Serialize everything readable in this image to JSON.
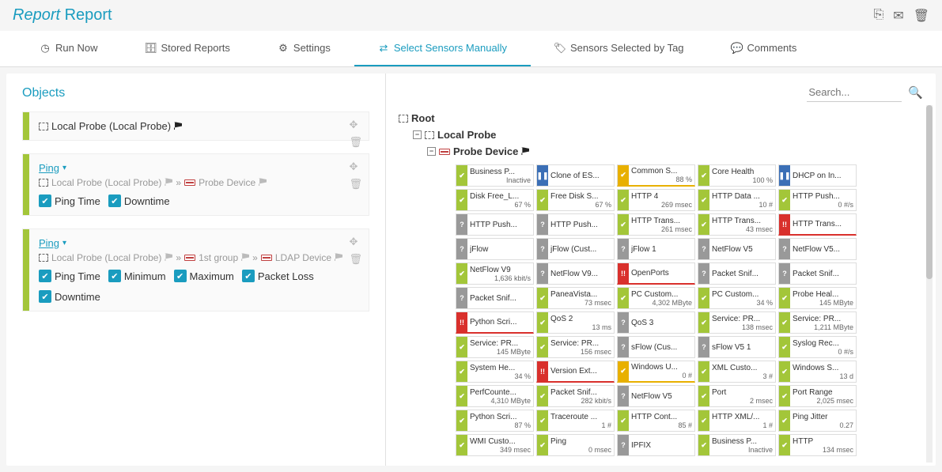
{
  "header": {
    "title_em": "Report",
    "title_rest": " Report"
  },
  "tabs": [
    {
      "label": "Run Now",
      "active": false
    },
    {
      "label": "Stored Reports",
      "active": false
    },
    {
      "label": "Settings",
      "active": false
    },
    {
      "label": "Select Sensors Manually",
      "active": true
    },
    {
      "label": "Sensors Selected by Tag",
      "active": false
    },
    {
      "label": "Comments",
      "active": false
    }
  ],
  "left": {
    "title": "Objects",
    "cards": [
      {
        "title": "Local Probe (Local Probe)",
        "title_link": false,
        "path": [],
        "checks": []
      },
      {
        "title": "Ping",
        "title_link": true,
        "path": [
          "Local Probe (Local Probe)",
          "Probe Device"
        ],
        "checks": [
          "Ping Time",
          "Downtime"
        ]
      },
      {
        "title": "Ping",
        "title_link": true,
        "path": [
          "Local Probe (Local Probe)",
          "1st group",
          "LDAP Device"
        ],
        "checks": [
          "Ping Time",
          "Minimum",
          "Maximum",
          "Packet Loss",
          "Downtime"
        ]
      }
    ]
  },
  "search": {
    "placeholder": "Search..."
  },
  "tree": {
    "root": "Root",
    "probe": "Local Probe",
    "device": "Probe Device"
  },
  "sensors": [
    {
      "name": "Business P...",
      "val": "Inactive",
      "stripe": "green",
      "mark": "✔"
    },
    {
      "name": "Clone of ES...",
      "val": "",
      "stripe": "blue",
      "mark": "❚❚"
    },
    {
      "name": "Common S...",
      "val": "88 %",
      "stripe": "yellow",
      "mark": "✔",
      "ul": "yellow"
    },
    {
      "name": "Core Health",
      "val": "100 %",
      "stripe": "green",
      "mark": "✔"
    },
    {
      "name": "DHCP on In...",
      "val": "",
      "stripe": "blue",
      "mark": "❚❚"
    },
    {
      "name": "Disk Free_L...",
      "val": "67 %",
      "stripe": "green",
      "mark": "✔"
    },
    {
      "name": "Free Disk S...",
      "val": "67 %",
      "stripe": "green",
      "mark": "✔"
    },
    {
      "name": "HTTP 4",
      "val": "269 msec",
      "stripe": "green",
      "mark": "✔"
    },
    {
      "name": "HTTP Data ...",
      "val": "10 #",
      "stripe": "green",
      "mark": "✔"
    },
    {
      "name": "HTTP Push...",
      "val": "0 #/s",
      "stripe": "green",
      "mark": "✔"
    },
    {
      "name": "HTTP Push...",
      "val": "",
      "stripe": "gray",
      "mark": "?"
    },
    {
      "name": "HTTP Push...",
      "val": "",
      "stripe": "gray",
      "mark": "?"
    },
    {
      "name": "HTTP Trans...",
      "val": "261 msec",
      "stripe": "green",
      "mark": "✔"
    },
    {
      "name": "HTTP Trans...",
      "val": "43 msec",
      "stripe": "green",
      "mark": "✔"
    },
    {
      "name": "HTTP Trans...",
      "val": "",
      "stripe": "red",
      "mark": "!!",
      "ul": "red"
    },
    {
      "name": "jFlow",
      "val": "",
      "stripe": "gray",
      "mark": "?"
    },
    {
      "name": "jFlow (Cust...",
      "val": "",
      "stripe": "gray",
      "mark": "?"
    },
    {
      "name": "jFlow 1",
      "val": "",
      "stripe": "gray",
      "mark": "?"
    },
    {
      "name": "NetFlow V5",
      "val": "",
      "stripe": "gray",
      "mark": "?"
    },
    {
      "name": "NetFlow V5...",
      "val": "",
      "stripe": "gray",
      "mark": "?"
    },
    {
      "name": "NetFlow V9",
      "val": "1,636 kbit/s",
      "stripe": "green",
      "mark": "✔"
    },
    {
      "name": "NetFlow V9...",
      "val": "",
      "stripe": "gray",
      "mark": "?"
    },
    {
      "name": "OpenPorts",
      "val": "",
      "stripe": "red",
      "mark": "!!",
      "ul": "red"
    },
    {
      "name": "Packet Snif...",
      "val": "",
      "stripe": "gray",
      "mark": "?"
    },
    {
      "name": "Packet Snif...",
      "val": "",
      "stripe": "gray",
      "mark": "?"
    },
    {
      "name": "Packet Snif...",
      "val": "",
      "stripe": "gray",
      "mark": "?"
    },
    {
      "name": "PaneaVista...",
      "val": "73 msec",
      "stripe": "green",
      "mark": "✔"
    },
    {
      "name": "PC Custom...",
      "val": "4,302 MByte",
      "stripe": "green",
      "mark": "✔"
    },
    {
      "name": "PC Custom...",
      "val": "34 %",
      "stripe": "green",
      "mark": "✔"
    },
    {
      "name": "Probe Heal...",
      "val": "145 MByte",
      "stripe": "green",
      "mark": "✔"
    },
    {
      "name": "Python Scri...",
      "val": "",
      "stripe": "red",
      "mark": "!!",
      "ul": "red"
    },
    {
      "name": "QoS 2",
      "val": "13 ms",
      "stripe": "green",
      "mark": "✔"
    },
    {
      "name": "QoS 3",
      "val": "",
      "stripe": "gray",
      "mark": "?"
    },
    {
      "name": "Service: PR...",
      "val": "138 msec",
      "stripe": "green",
      "mark": "✔"
    },
    {
      "name": "Service: PR...",
      "val": "1,211 MByte",
      "stripe": "green",
      "mark": "✔"
    },
    {
      "name": "Service: PR...",
      "val": "145 MByte",
      "stripe": "green",
      "mark": "✔"
    },
    {
      "name": "Service: PR...",
      "val": "156 msec",
      "stripe": "green",
      "mark": "✔"
    },
    {
      "name": "sFlow (Cus...",
      "val": "",
      "stripe": "gray",
      "mark": "?"
    },
    {
      "name": "sFlow V5 1",
      "val": "",
      "stripe": "gray",
      "mark": "?"
    },
    {
      "name": "Syslog Rec...",
      "val": "0 #/s",
      "stripe": "green",
      "mark": "✔"
    },
    {
      "name": "System He...",
      "val": "34 %",
      "stripe": "green",
      "mark": "✔"
    },
    {
      "name": "Version Ext...",
      "val": "",
      "stripe": "red",
      "mark": "!!",
      "ul": "red"
    },
    {
      "name": "Windows U...",
      "val": "0 #",
      "stripe": "yellow",
      "mark": "✔",
      "ul": "yellow"
    },
    {
      "name": "XML Custo...",
      "val": "3 #",
      "stripe": "green",
      "mark": "✔"
    },
    {
      "name": "Windows S...",
      "val": "13 d",
      "stripe": "green",
      "mark": "✔"
    },
    {
      "name": "PerfCounte...",
      "val": "4,310 MByte",
      "stripe": "green",
      "mark": "✔"
    },
    {
      "name": "Packet Snif...",
      "val": "282 kbit/s",
      "stripe": "green",
      "mark": "✔"
    },
    {
      "name": "NetFlow V5",
      "val": "",
      "stripe": "gray",
      "mark": "?"
    },
    {
      "name": "Port",
      "val": "2 msec",
      "stripe": "green",
      "mark": "✔"
    },
    {
      "name": "Port Range",
      "val": "2,025 msec",
      "stripe": "green",
      "mark": "✔"
    },
    {
      "name": "Python Scri...",
      "val": "87 %",
      "stripe": "green",
      "mark": "✔"
    },
    {
      "name": "Traceroute ...",
      "val": "1 #",
      "stripe": "green",
      "mark": "✔"
    },
    {
      "name": "HTTP Cont...",
      "val": "85 #",
      "stripe": "green",
      "mark": "✔"
    },
    {
      "name": "HTTP XML/...",
      "val": "1 #",
      "stripe": "green",
      "mark": "✔"
    },
    {
      "name": "Ping Jitter",
      "val": "0.27",
      "stripe": "green",
      "mark": "✔"
    },
    {
      "name": "WMI Custo...",
      "val": "349 msec",
      "stripe": "green",
      "mark": "✔"
    },
    {
      "name": "Ping",
      "val": "0 msec",
      "stripe": "green",
      "mark": "✔"
    },
    {
      "name": "IPFIX",
      "val": "",
      "stripe": "gray",
      "mark": "?"
    },
    {
      "name": "Business P...",
      "val": "Inactive",
      "stripe": "green",
      "mark": "✔"
    },
    {
      "name": "HTTP",
      "val": "134 msec",
      "stripe": "green",
      "mark": "✔"
    }
  ]
}
